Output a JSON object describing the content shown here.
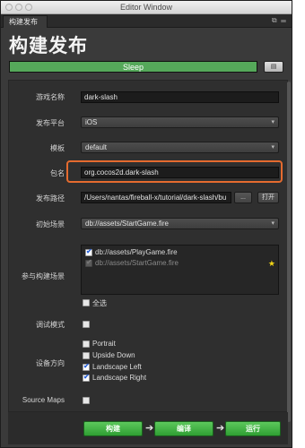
{
  "window": {
    "title": "Editor Window",
    "tab": "构建发布"
  },
  "heading": "构建发布",
  "progress": {
    "status": "Sleep",
    "percent": 100
  },
  "form": {
    "game_name_label": "游戏名称",
    "game_name_value": "dark-slash",
    "platform_label": "发布平台",
    "platform_value": "iOS",
    "template_label": "模板",
    "template_value": "default",
    "package_label": "包名",
    "package_value": "org.cocos2d.dark-slash",
    "path_label": "发布路径",
    "path_value": "/Users/nantas/fireball-x/tutorial/dark-slash/bu",
    "path_browse": "...",
    "path_open": "打开",
    "start_scene_label": "初始场景",
    "start_scene_value": "db://assets/StartGame.fire",
    "scenes_label": "参与构建场景",
    "scenes": [
      {
        "name": "db://assets/PlayGame.fire",
        "checked": true,
        "disabled": false
      },
      {
        "name": "db://assets/StartGame.fire",
        "checked": true,
        "disabled": true
      }
    ],
    "select_all_label": "全选",
    "debug_label": "调试模式",
    "orientation_label": "设备方向",
    "orientations": [
      {
        "name": "Portrait",
        "checked": false
      },
      {
        "name": "Upside Down",
        "checked": false
      },
      {
        "name": "Landscape Left",
        "checked": true
      },
      {
        "name": "Landscape Right",
        "checked": true
      }
    ],
    "source_maps_label": "Source Maps"
  },
  "actions": {
    "build": "构建",
    "compile": "编译",
    "run": "运行"
  },
  "colors": {
    "highlight": "#e56b2f",
    "action_green": "#3aa83e",
    "progress_green": "#55a85a"
  }
}
